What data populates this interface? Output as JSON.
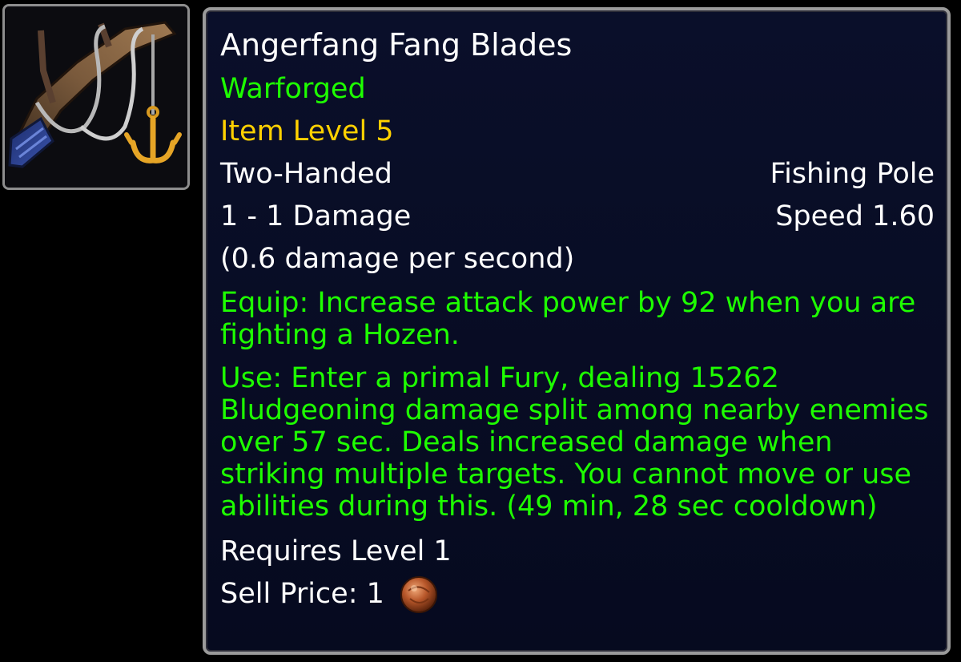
{
  "item": {
    "icon": "fishing-pole-icon",
    "name": "Angerfang Fang Blades",
    "tier": "Warforged",
    "item_level": "Item Level 5",
    "slot": "Two-Handed",
    "weapon_type": "Fishing Pole",
    "damage": "1 - 1 Damage",
    "speed": "Speed 1.60",
    "dps": "(0.6 damage per second)",
    "equip_text": "Equip: Increase attack power by 92 when you are fighting a Hozen.",
    "use_text": "Use: Enter a primal Fury, dealing 15262 Bludgeoning damage split among nearby enemies over 57 sec. Deals increased damage when striking multiple targets. You cannot move or use abilities during this. (49 min, 28 sec cooldown)",
    "requires": "Requires Level 1",
    "sell_label": "Sell Price: 1",
    "sell_coin_icon": "copper-coin-icon"
  },
  "colors": {
    "name": "#ffffff",
    "green": "#1eff00",
    "item_level": "#ffd100",
    "background": "#060a1f",
    "border": "#9a9a9a"
  }
}
